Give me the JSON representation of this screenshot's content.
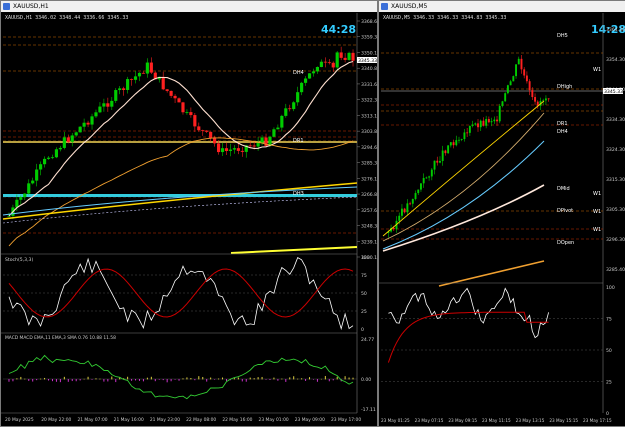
{
  "left": {
    "title": "XAUUSD,H1",
    "ohlc": "XAUUSD,H1  3346.02 3348.44 3336.66 3345.33",
    "timer": "44:28",
    "price_labels": [
      "3368.60",
      "3359.35",
      "3350.10",
      "3340.85",
      "3331.60",
      "3322.35",
      "3313.10",
      "3303.85",
      "3294.60",
      "3285.35",
      "3276.10",
      "3266.85",
      "3257.60",
      "3248.35",
      "3239.10",
      "3230.10"
    ],
    "current_price": "3345.33",
    "time_labels": [
      "20 May 2025",
      "20 May 22:00",
      "21 May 07:00",
      "21 May 16:00",
      "21 May 23:00",
      "22 May 08:00",
      "22 May 16:00",
      "23 May 01:00",
      "23 May 09:00",
      "23 May 17:00"
    ],
    "zone_labels": {
      "dh4": "DH4",
      "dr1": "DR1",
      "dh3": "DH3"
    },
    "stoch_title": "Stoch(5,3,3)",
    "stoch_levels": [
      "100",
      "75",
      "50",
      "25",
      "0"
    ],
    "macd_title": "MACD MACD EMA,11 EMA,3 SMA 0.76 10.88 11.58",
    "macd_levels": [
      "24.77",
      "0.00",
      "-17.11"
    ]
  },
  "right": {
    "title": "XAUUSD,M5",
    "ohlc": "XAUUSD,M5  3346.33 3346.33 3344.83 3345.33",
    "timer": "14:28",
    "price_labels": [
      "3364.30",
      "3354.30",
      "3344.30",
      "3334.30",
      "3324.30",
      "3315.30",
      "3305.30",
      "3296.30",
      "3285.40"
    ],
    "current_price": "3345.33",
    "time_labels": [
      "23 May 01:25",
      "23 May 07:15",
      "23 May 09:15",
      "23 May 11:15",
      "23 May 13:15",
      "23 May 15:15",
      "23 May 17:15"
    ],
    "zone_labels": {
      "dh5": "DH5",
      "dhigh": "DHigh",
      "dr1": "DR1",
      "dh4": "DH4",
      "dmid": "DMid",
      "dpivot": "DPivot",
      "dopen": "DOpen",
      "w1": "W1",
      "w2": "W1",
      "w3": "W1",
      "w4": "W1"
    },
    "stoch_levels": [
      "100",
      "75",
      "50",
      "25",
      "0"
    ]
  },
  "colors": {
    "bull": "#00cc00",
    "bear": "#ff2020",
    "ma_fast": "#ffd700",
    "ma_mid": "#f0a030",
    "ma_slow": "#ffffff",
    "ma_blue": "#66ccff",
    "stoch_main": "#ffffff",
    "stoch_signal": "#cc0000",
    "macd_line": "#33cc33",
    "macd_hist": "#cc33cc",
    "timer": "#33ccff"
  }
}
